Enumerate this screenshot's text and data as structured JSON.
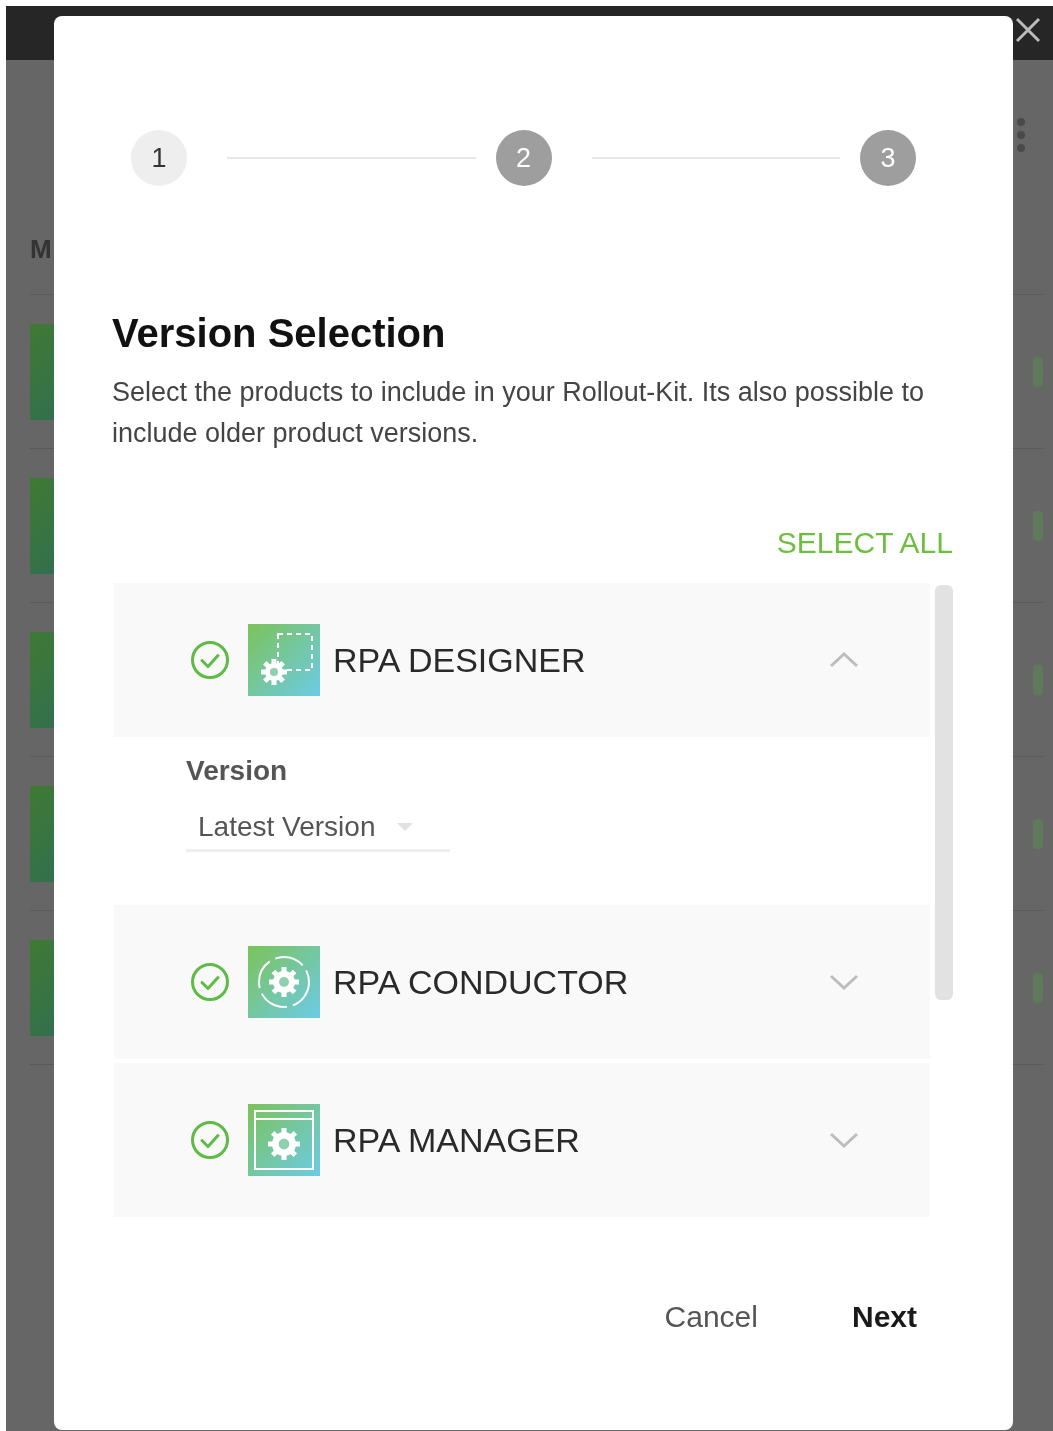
{
  "background": {
    "heading": "M"
  },
  "stepper": [
    {
      "label": "1",
      "active": true
    },
    {
      "label": "2",
      "active": false
    },
    {
      "label": "3",
      "active": false
    }
  ],
  "title": "Version Selection",
  "description": "Select the products to include in your Rollout-Kit. Its also possible to include older product versions.",
  "select_all": "SELECT ALL",
  "products": [
    {
      "name": "RPA DESIGNER",
      "kind": "designer",
      "checked": true,
      "expanded": true,
      "version_label": "Version",
      "version_value": "Latest Version"
    },
    {
      "name": "RPA CONDUCTOR",
      "kind": "conductor",
      "checked": true,
      "expanded": false
    },
    {
      "name": "RPA MANAGER",
      "kind": "manager",
      "checked": true,
      "expanded": false
    }
  ],
  "buttons": [
    {
      "label": "Cancel",
      "kind": "secondary"
    },
    {
      "label": "Next",
      "kind": "primary"
    }
  ]
}
